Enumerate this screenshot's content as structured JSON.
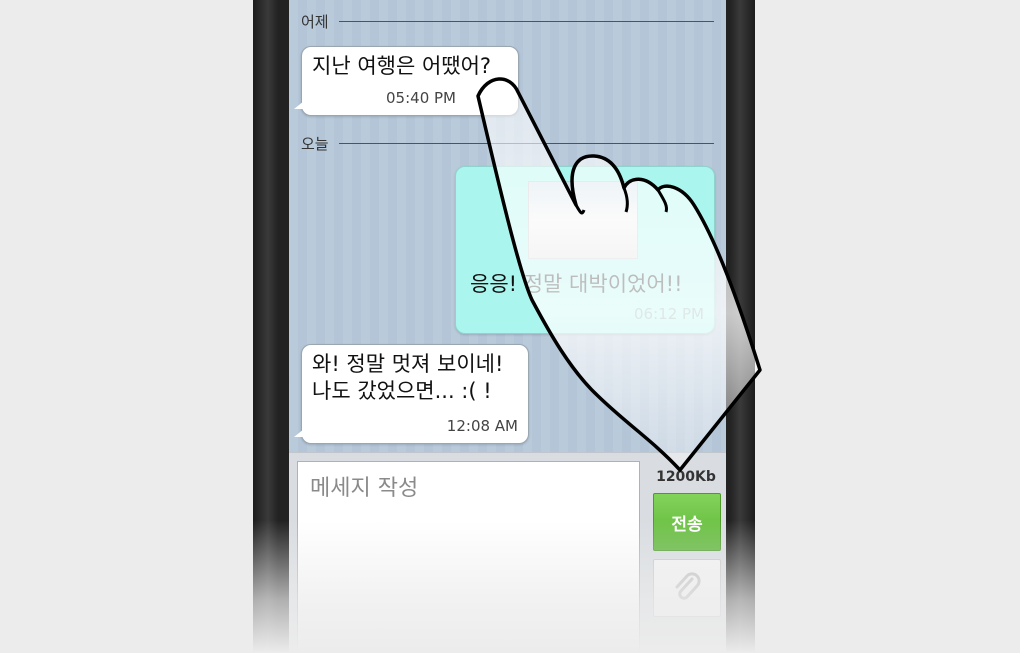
{
  "chat": {
    "dividers": {
      "yesterday": "어제",
      "today": "오늘"
    },
    "messages": [
      {
        "text": "지난 여행은 어땠어?",
        "time": "05:40 PM",
        "direction": "received"
      },
      {
        "text": "응응! 정말 대박이었어!!",
        "time": "06:12 PM",
        "direction": "sent",
        "has_photo": true
      },
      {
        "text": "와! 정말 멋져 보이네!\n나도 갔었으면... :( !",
        "time": "12:08 AM",
        "direction": "received"
      }
    ]
  },
  "composer": {
    "placeholder": "메세지 작성",
    "size_label": "1200Kb",
    "send_label": "전송",
    "attach_icon": "paperclip-icon"
  },
  "colors": {
    "chat_background": "#b9cadb",
    "sent_bubble": "#aaf6ee",
    "send_button": "#6cc446"
  }
}
